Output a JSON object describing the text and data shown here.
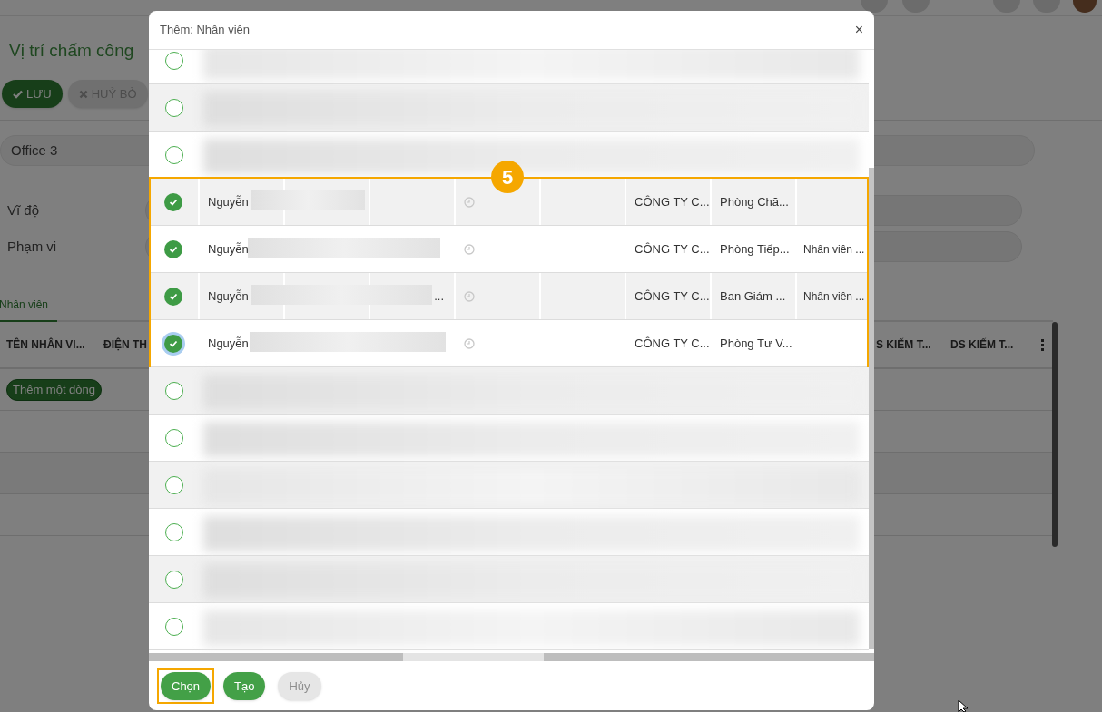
{
  "page": {
    "title": "Vị trí chấm công",
    "buttons": [
      {
        "label": "LƯU",
        "disabled": false
      },
      {
        "label": "HUỶ BỎ",
        "disabled": true
      }
    ],
    "location": "Office 3",
    "fields": [
      {
        "label": "Vĩ độ"
      },
      {
        "label": "Phạm vi"
      }
    ],
    "tabs": [
      {
        "label": "Nhân viên",
        "selected": true
      }
    ],
    "table": {
      "columns": [
        "TÊN NHÂN VI...",
        "ĐIỆN TH",
        "S KIẾM T...",
        "DS KIẾM T..."
      ],
      "add_row": "Thêm một dòng"
    }
  },
  "dialog": {
    "title": "Thêm: Nhân viên",
    "close": "×",
    "rows": [
      {
        "kind": "redacted",
        "selected": false
      },
      {
        "kind": "redacted",
        "selected": false
      },
      {
        "kind": "redacted",
        "selected": false
      },
      {
        "kind": "employee",
        "selected": true,
        "focused": false,
        "name": "Nguyễn",
        "company": "CÔNG TY C...",
        "department": "Phòng Chă..."
      },
      {
        "kind": "employee",
        "selected": true,
        "focused": false,
        "name": "Nguyễn",
        "company": "CÔNG TY C...",
        "department": "Phòng Tiếp...",
        "position": "Nhân viên ..."
      },
      {
        "kind": "employee",
        "selected": true,
        "focused": false,
        "name": "Nguyễn",
        "column_4": "...",
        "company": "CÔNG TY C...",
        "department": "Ban Giám ...",
        "position": "Nhân viên ..."
      },
      {
        "kind": "employee",
        "selected": true,
        "focused": true,
        "name": "Nguyễn",
        "company": "CÔNG TY C...",
        "department": "Phòng Tư V..."
      },
      {
        "kind": "redacted",
        "selected": false
      },
      {
        "kind": "redacted",
        "selected": false
      },
      {
        "kind": "redacted",
        "selected": false
      },
      {
        "kind": "redacted",
        "selected": false
      },
      {
        "kind": "redacted",
        "selected": false
      },
      {
        "kind": "redacted",
        "selected": false
      }
    ],
    "buttons": [
      {
        "label": "Chọn",
        "disabled": false,
        "highlighted": true
      },
      {
        "label": "Tạo",
        "disabled": false,
        "highlighted": false
      },
      {
        "label": "Hủy",
        "disabled": true,
        "highlighted": false
      }
    ]
  },
  "annotation": {
    "label": "5"
  }
}
